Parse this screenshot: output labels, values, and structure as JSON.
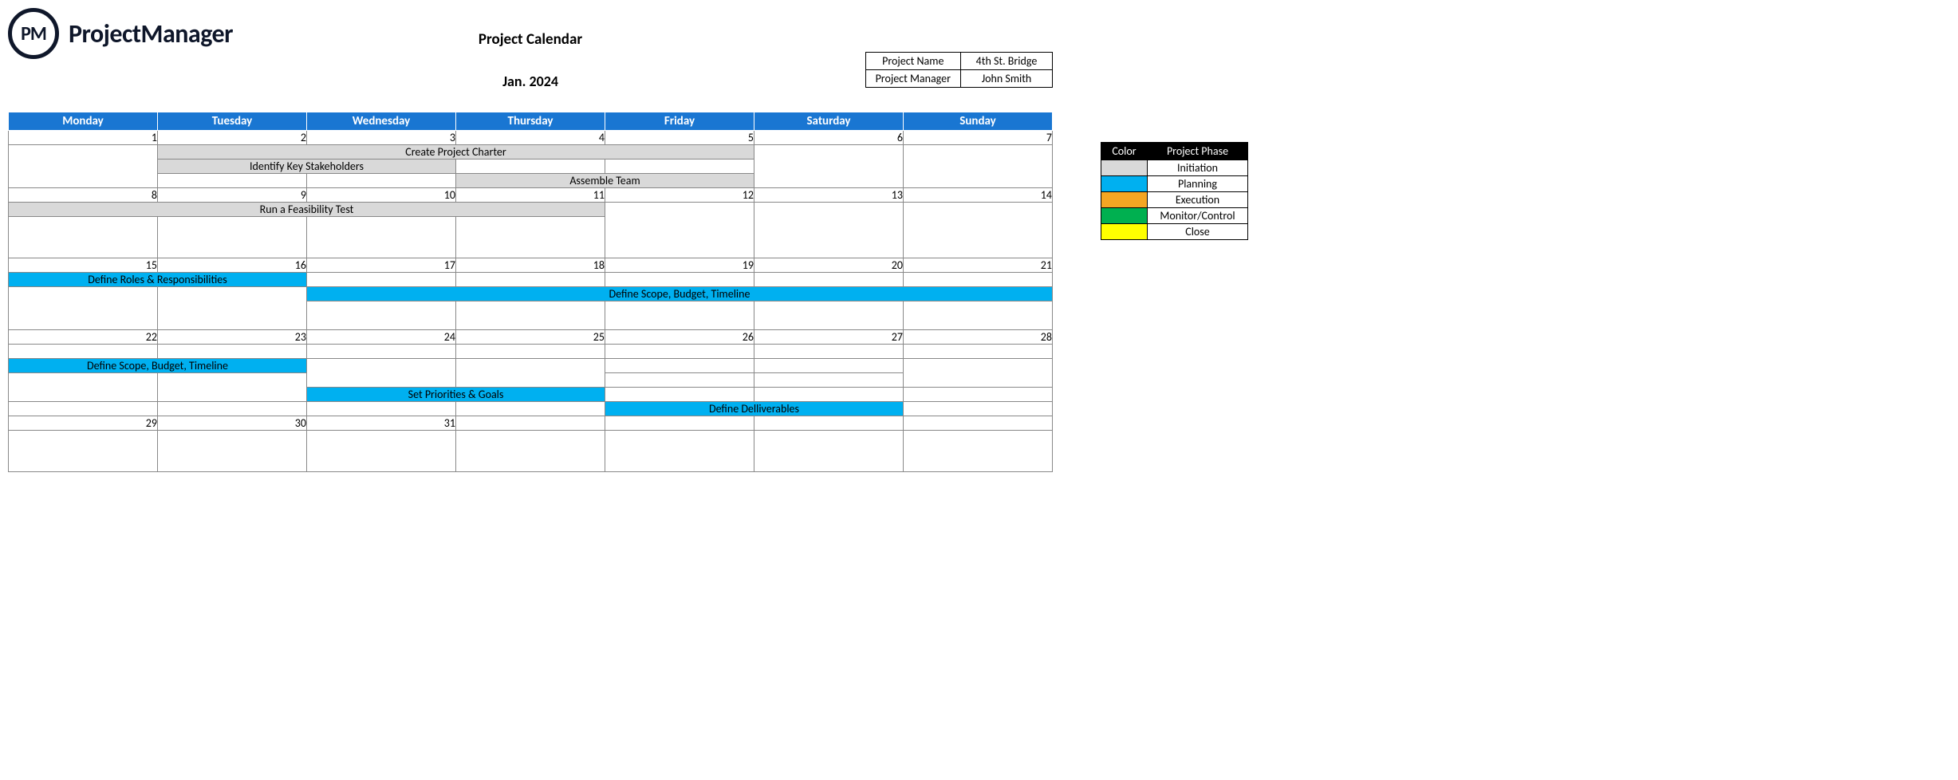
{
  "logo": {
    "badge": "PM",
    "text": "ProjectManager"
  },
  "title": "Project Calendar",
  "month": "Jan. 2024",
  "meta": {
    "project_name_label": "Project Name",
    "project_name_value": "4th St. Bridge",
    "project_manager_label": "Project Manager",
    "project_manager_value": "John Smith"
  },
  "days": [
    "Monday",
    "Tuesday",
    "Wednesday",
    "Thursday",
    "Friday",
    "Saturday",
    "Sunday"
  ],
  "weeks": {
    "w1": [
      "1",
      "2",
      "3",
      "4",
      "5",
      "6",
      "7"
    ],
    "w2": [
      "8",
      "9",
      "10",
      "11",
      "12",
      "13",
      "14"
    ],
    "w3": [
      "15",
      "16",
      "17",
      "18",
      "19",
      "20",
      "21"
    ],
    "w4": [
      "22",
      "23",
      "24",
      "25",
      "26",
      "27",
      "28"
    ],
    "w5": [
      "29",
      "30",
      "31",
      "",
      "",
      "",
      ""
    ]
  },
  "tasks": {
    "create_charter": "Create Project Charter",
    "identify_stakeholders": "Identify Key Stakeholders",
    "assemble_team": "Assemble Team",
    "feasibility": "Run a Feasibility Test",
    "roles": "Define Roles & Responsibilities",
    "scope": "Define Scope, Budget, Timeline",
    "scope2": "Define Scope, Budget, Timeline",
    "priorities": "Set Priorities & Goals",
    "deliverables": "Define Delliverables"
  },
  "legend": {
    "col_color": "Color",
    "col_phase": "Project Phase",
    "rows": [
      {
        "phase": "Initiation",
        "class": "initiation"
      },
      {
        "phase": "Planning",
        "class": "planning"
      },
      {
        "phase": "Execution",
        "class": "execution"
      },
      {
        "phase": "Monitor/Control",
        "class": "monitor"
      },
      {
        "phase": "Close",
        "class": "close"
      }
    ]
  }
}
